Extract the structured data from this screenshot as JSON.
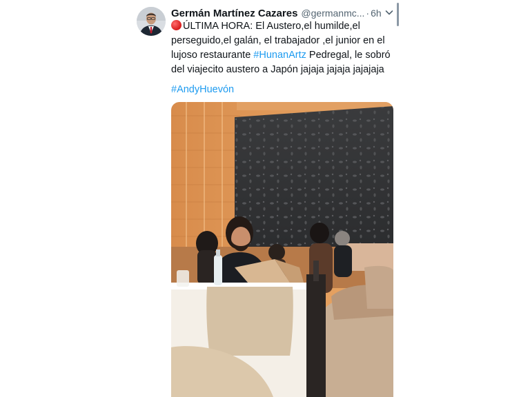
{
  "tweet": {
    "author_name": "Germán Martínez Cazares",
    "handle": "@germanmc...",
    "separator": "·",
    "time": "6h",
    "text_line1": "ÚLTIMA HORA: El Austero,el humilde,el",
    "text_line2": "perseguido,el galán, el trabajador ,el junior en el",
    "text_line3_pre": "lujoso restaurante ",
    "text_line3_tag": "#HunanArtz",
    "text_line3_post": " Pedregal, le sobró",
    "text_line4": "del viajecito austero a Japón jajaja jajaja jajajaja",
    "hashtag": "#AndyHuevón"
  },
  "colors": {
    "link": "#1d9bf0",
    "text": "#0f1419",
    "muted": "#536471"
  },
  "icons": {
    "status": "red-circle-emoji",
    "more": "chevron-down-icon"
  }
}
